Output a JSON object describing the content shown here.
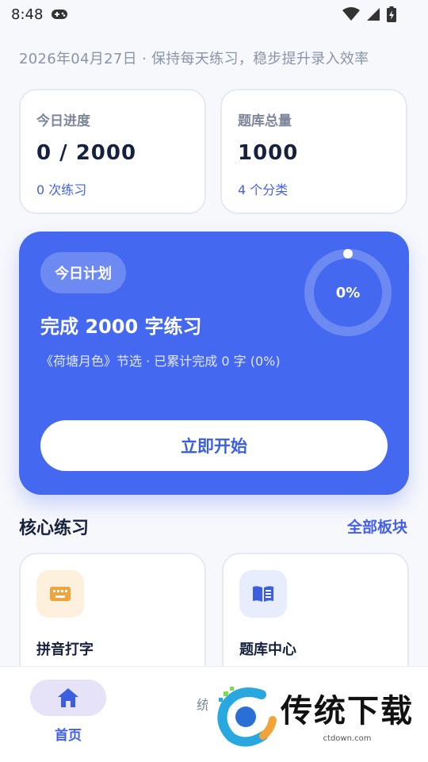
{
  "status_bar": {
    "time": "8:48"
  },
  "header": {
    "subtitle": "2026年04月27日 · 保持每天练习，稳步提升录入效率"
  },
  "stats": [
    {
      "label": "今日进度",
      "value": "0 / 2000",
      "sub": "0 次练习"
    },
    {
      "label": "题库总量",
      "value": "1000",
      "sub": "4 个分类"
    }
  ],
  "plan": {
    "badge": "今日计划",
    "title": "完成 2000 字练习",
    "description": "《荷塘月色》节选 · 已累计完成 0 字 (0%)",
    "progress_label": "0%",
    "progress_value": 0,
    "start_label": "立即开始"
  },
  "core": {
    "title": "核心练习",
    "link": "全部板块",
    "items": [
      {
        "label": "拼音打字",
        "icon": "keyboard-icon",
        "color": "#f2a33a"
      },
      {
        "label": "题库中心",
        "icon": "book-icon",
        "color": "#3c5fe0"
      }
    ]
  },
  "nav": {
    "items": [
      {
        "label": "首页",
        "icon": "home-icon"
      },
      {
        "label": "统"
      }
    ]
  },
  "watermark": {
    "title": "传统下载",
    "domain": "ctdown.com"
  },
  "colors": {
    "accent": "#4469f0",
    "link": "#4360e8"
  }
}
